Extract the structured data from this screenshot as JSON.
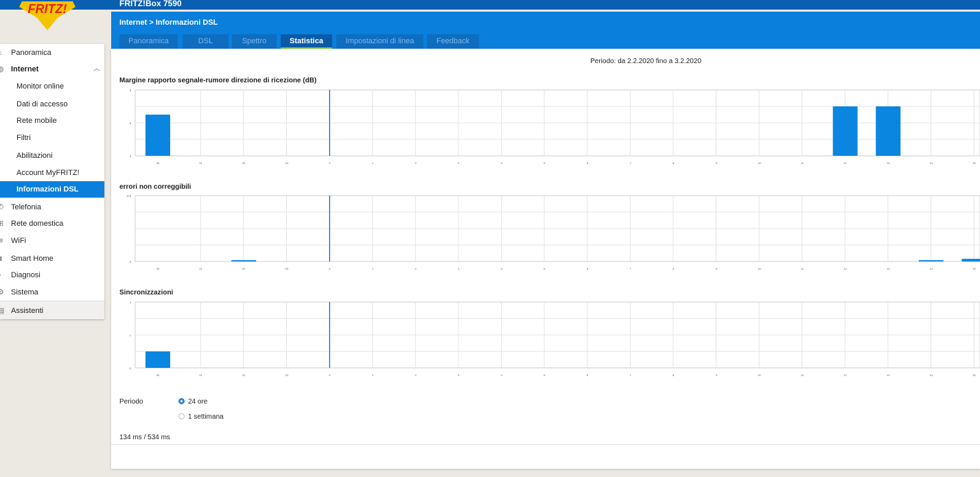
{
  "header": {
    "device": "FRITZ!Box 7590",
    "breadcrumb": "Internet > Informazioni DSL"
  },
  "logo": {
    "text": "FRITZ!"
  },
  "sidebar": {
    "items": [
      {
        "label": "Panoramica",
        "icon": "home-icon"
      },
      {
        "label": "Internet",
        "icon": "globe-icon"
      },
      {
        "label": "Monitor online"
      },
      {
        "label": "Dati di accesso"
      },
      {
        "label": "Rete mobile"
      },
      {
        "label": "Filtri"
      },
      {
        "label": "Abilitazioni"
      },
      {
        "label": "Account MyFRITZ!"
      },
      {
        "label": "Informazioni DSL"
      },
      {
        "label": "Telefonia",
        "icon": "phone-icon"
      },
      {
        "label": "Rete domestica",
        "icon": "network-icon"
      },
      {
        "label": "WiFi",
        "icon": "wifi-icon"
      },
      {
        "label": "Smart Home",
        "icon": "smarthome-icon"
      },
      {
        "label": "Diagnosi",
        "icon": "diagnosis-icon"
      },
      {
        "label": "Sistema",
        "icon": "gear-icon"
      },
      {
        "label": "Assistenti",
        "icon": "wizard-icon"
      }
    ]
  },
  "tabs": [
    {
      "label": "Panoramica"
    },
    {
      "label": "DSL"
    },
    {
      "label": "Spettro"
    },
    {
      "label": "Statistica"
    },
    {
      "label": "Impostazioni di linea"
    },
    {
      "label": "Feedback"
    }
  ],
  "main": {
    "period_text": "Periodo: da 2.2.2020 fino a 3.2.2020",
    "period_label": "Periodo",
    "radio_24h": "24 ore",
    "radio_week": "1 settimana",
    "timing": "134 ms / 534 ms"
  },
  "colors": {
    "bar": "#0a86e0",
    "accent": "#0a7fdc",
    "grid": "#dddddd"
  },
  "chart_data": [
    {
      "type": "bar",
      "title": "Margine rapporto segnale-rumore direzione di ricezione (dB)",
      "categories": [
        "20",
        "21",
        "22",
        "23",
        "0",
        "1",
        "2",
        "3",
        "4",
        "5",
        "6",
        "7",
        "8",
        "9",
        "10",
        "11",
        "12",
        "13",
        "14",
        "15"
      ],
      "values": [
        5.5,
        0,
        0,
        0,
        0,
        0,
        0,
        0,
        0,
        0,
        0,
        0,
        0,
        0,
        0,
        0,
        6,
        6,
        0,
        0
      ],
      "ylim": [
        3,
        7
      ],
      "ytick_labels": [
        "3",
        "5",
        "6"
      ]
    },
    {
      "type": "bar",
      "title": "errori non correggibili",
      "categories": [
        "20",
        "21",
        "22",
        "23",
        "0",
        "1",
        "2",
        "3",
        "4",
        "5",
        "6",
        "7",
        "8",
        "9",
        "10",
        "11",
        "12",
        "13",
        "14",
        "15"
      ],
      "values": [
        0,
        0,
        2,
        0,
        0,
        0,
        0,
        0,
        0,
        0,
        0,
        0,
        0,
        0,
        0,
        0,
        0,
        0,
        2,
        4
      ],
      "ylim": [
        0,
        100
      ],
      "ytick_labels": [
        "0",
        "475"
      ]
    },
    {
      "type": "bar",
      "title": "Sincronizzazioni",
      "categories": [
        "20",
        "21",
        "22",
        "23",
        "0",
        "1",
        "2",
        "3",
        "4",
        "5",
        "6",
        "7",
        "8",
        "9",
        "10",
        "11",
        "12",
        "13",
        "14",
        "15"
      ],
      "values": [
        0.5,
        0,
        0,
        0,
        0,
        0,
        0,
        0,
        0,
        0,
        0,
        0,
        0,
        0,
        0,
        0,
        0,
        0,
        0,
        0
      ],
      "ylim": [
        0,
        2
      ],
      "ytick_labels": [
        "0",
        "1",
        "4"
      ]
    }
  ]
}
